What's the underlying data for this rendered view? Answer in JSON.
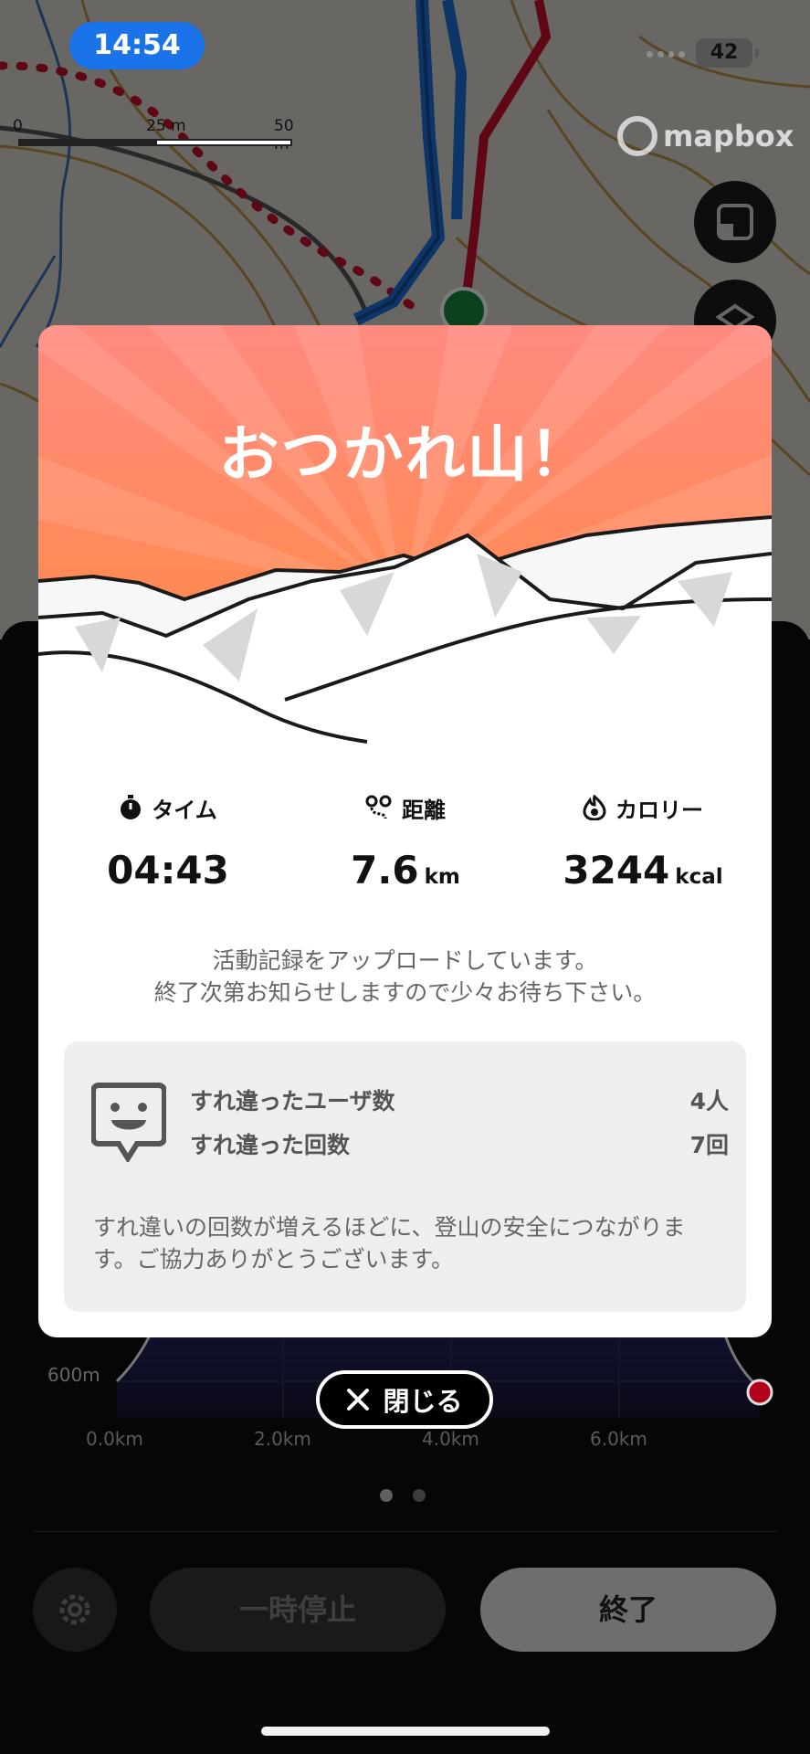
{
  "status_bar": {
    "time": "14:54",
    "battery": "42"
  },
  "map": {
    "scale_labels": [
      "0",
      "25 m",
      "50 m"
    ],
    "attribution": "mapbox",
    "buttons": [
      "expand-icon",
      "layers-icon"
    ]
  },
  "modal": {
    "title": "おつかれ山！",
    "stats": [
      {
        "label": "タイム",
        "value": "04:43",
        "unit": "",
        "icon": "stopwatch-icon"
      },
      {
        "label": "距離",
        "value": "7.6",
        "unit": "km",
        "icon": "route-icon"
      },
      {
        "label": "カロリー",
        "value": "3244",
        "unit": "kcal",
        "icon": "flame-icon"
      }
    ],
    "upload_message": [
      "活動記録をアップロードしています。",
      "終了次第お知らせしますので少々お待ち下さい。"
    ],
    "passing": {
      "icon": "smile-face-icon",
      "users_label": "すれ違ったユーザ数",
      "users_value": "4人",
      "count_label": "すれ違った回数",
      "count_value": "7回",
      "note": "すれ違いの回数が増えるほどに、登山の安全につながります。ご協力ありがとうございます。"
    }
  },
  "close_button": {
    "label": "閉じる",
    "icon": "close-icon"
  },
  "elevation_chart": {
    "y_label": "600m",
    "x_labels": [
      "0.0km",
      "2.0km",
      "4.0km",
      "6.0km"
    ]
  },
  "pager": {
    "pages": 2,
    "current": 1
  },
  "bottom_bar": {
    "settings_icon": "gear-icon",
    "pause_label": "一時停止",
    "end_label": "終了"
  },
  "colors": {
    "accent_blue": "#1a73e8",
    "sunset_top": "#ff8a80",
    "sunset_bottom": "#ff8a3d",
    "route_red": "#c8102e",
    "route_blue": "#1e6fd9"
  }
}
